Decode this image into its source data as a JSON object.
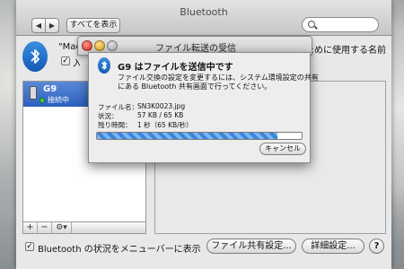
{
  "window": {
    "title": "Bluetooth",
    "back_icon": "◀",
    "forward_icon": "▶",
    "show_all_label": "すべてを表示",
    "search_placeholder": ""
  },
  "pane": {
    "device_name_label": "\"MacBook",
    "name_note": "ために使用する名前",
    "discoverable_checked": true,
    "discoverable_label": "入"
  },
  "devices": [
    {
      "name": "G9",
      "status": "接続中"
    }
  ],
  "list_buttons": {
    "add": "+",
    "remove": "−",
    "gear": "⚙▾"
  },
  "bottom": {
    "menu_checked": true,
    "menu_label": "Bluetooth の状況をメニューバーに表示",
    "file_sharing_button": "ファイル共有設定...",
    "advanced_button": "詳細設定...",
    "help": "?"
  },
  "transfer_window": {
    "title": "ファイル転送の受信"
  },
  "dialog": {
    "title": "G9 はファイルを送信中です",
    "message_line1": "ファイル交換の設定を変更するには、システム環境設定の共有",
    "message_line2": "にある Bluetooth 共有画面で行ってください。",
    "file_name_label": "ファイル名：",
    "file_name": "SN3K0023.jpg",
    "status_label": "状況：",
    "status": "57 KB / 65 KB",
    "remaining_label": "残り時間：",
    "remaining": "1 秒（65 KB/秒）",
    "progress": 0.88,
    "cancel_label": "キャンセル"
  },
  "colors": {
    "accent": "#2b5fbf",
    "progress": "#3b85dc",
    "connected": "#3fd23f"
  }
}
